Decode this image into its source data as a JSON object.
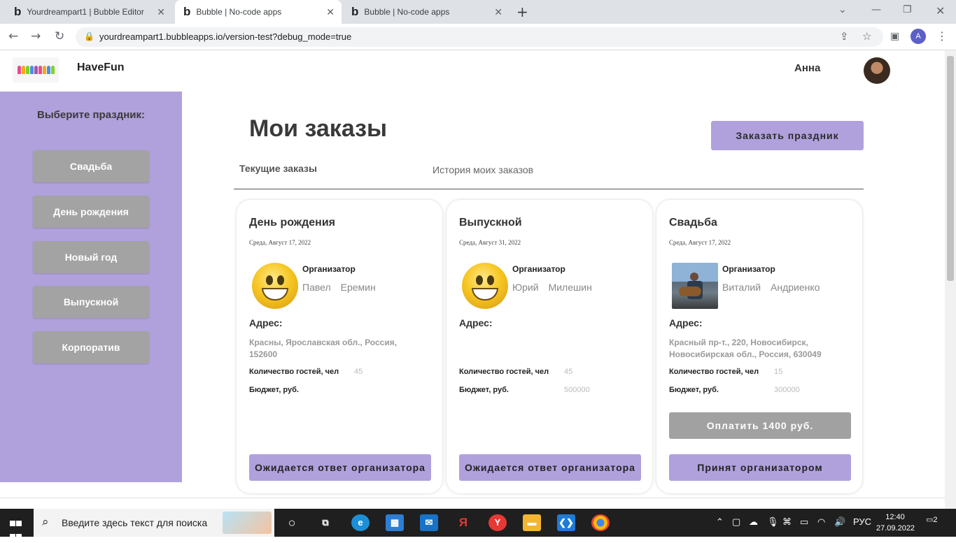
{
  "browser": {
    "tabs": [
      {
        "label": "Yourdreampart1 | Bubble Editor"
      },
      {
        "label": "Bubble | No-code apps"
      },
      {
        "label": "Bubble | No-code apps"
      }
    ],
    "url": "yourdreampart1.bubbleapps.io/version-test?debug_mode=true",
    "profile_initial": "A"
  },
  "header": {
    "brand": "HaveFun",
    "username": "Анна"
  },
  "sidebar": {
    "title": "Выберите праздник:",
    "items": [
      {
        "label": "Свадьба"
      },
      {
        "label": "День рождения"
      },
      {
        "label": "Новый год"
      },
      {
        "label": "Выпускной"
      },
      {
        "label": "Корпоратив"
      }
    ]
  },
  "main": {
    "title": "Мои заказы",
    "order_button": "Заказать праздник",
    "tabs": {
      "current": "Текущие заказы",
      "history": "История моих заказов"
    },
    "cards": [
      {
        "title": "День рождения",
        "date": "Среда, Август 17, 2022",
        "organizer_label": "Организатор",
        "organizer_first": "Павел",
        "organizer_last": "Еремин",
        "address_label": "Адрес:",
        "address": "Красны, Ярославская обл., Россия, 152600",
        "guests_label": "Количество гостей, чел",
        "guests": "45",
        "budget_label": "Бюджет, руб.",
        "budget": "",
        "status": "Ожидается ответ организатора"
      },
      {
        "title": "Выпускной",
        "date": "Среда, Август 31, 2022",
        "organizer_label": "Организатор",
        "organizer_first": "Юрий",
        "organizer_last": "Милешин",
        "address_label": "Адрес:",
        "address": "",
        "guests_label": "Количество гостей, чел",
        "guests": "45",
        "budget_label": "Бюджет, руб.",
        "budget": "500000",
        "status": "Ожидается ответ организатора"
      },
      {
        "title": "Свадьба",
        "date": "Среда, Август 17, 2022",
        "organizer_label": "Организатор",
        "organizer_first": "Виталий",
        "organizer_last": "Андриенко",
        "address_label": "Адрес:",
        "address": "Красный пр-т., 220, Новосибирск, Новосибирская обл., Россия, 630049",
        "guests_label": "Количество гостей, чел",
        "guests": "15",
        "budget_label": "Бюджет, руб.",
        "budget": "300000",
        "pay_button": "Оплатить 1400 руб.",
        "status": "Принят организатором"
      }
    ]
  },
  "taskbar": {
    "search_placeholder": "Введите здесь текст для поиска",
    "language": "РУС",
    "time": "12:40",
    "date": "27.09.2022",
    "notifications": "2"
  },
  "colors": {
    "accent_purple": "#b0a1dd",
    "button_gray": "#a3a3a3"
  }
}
